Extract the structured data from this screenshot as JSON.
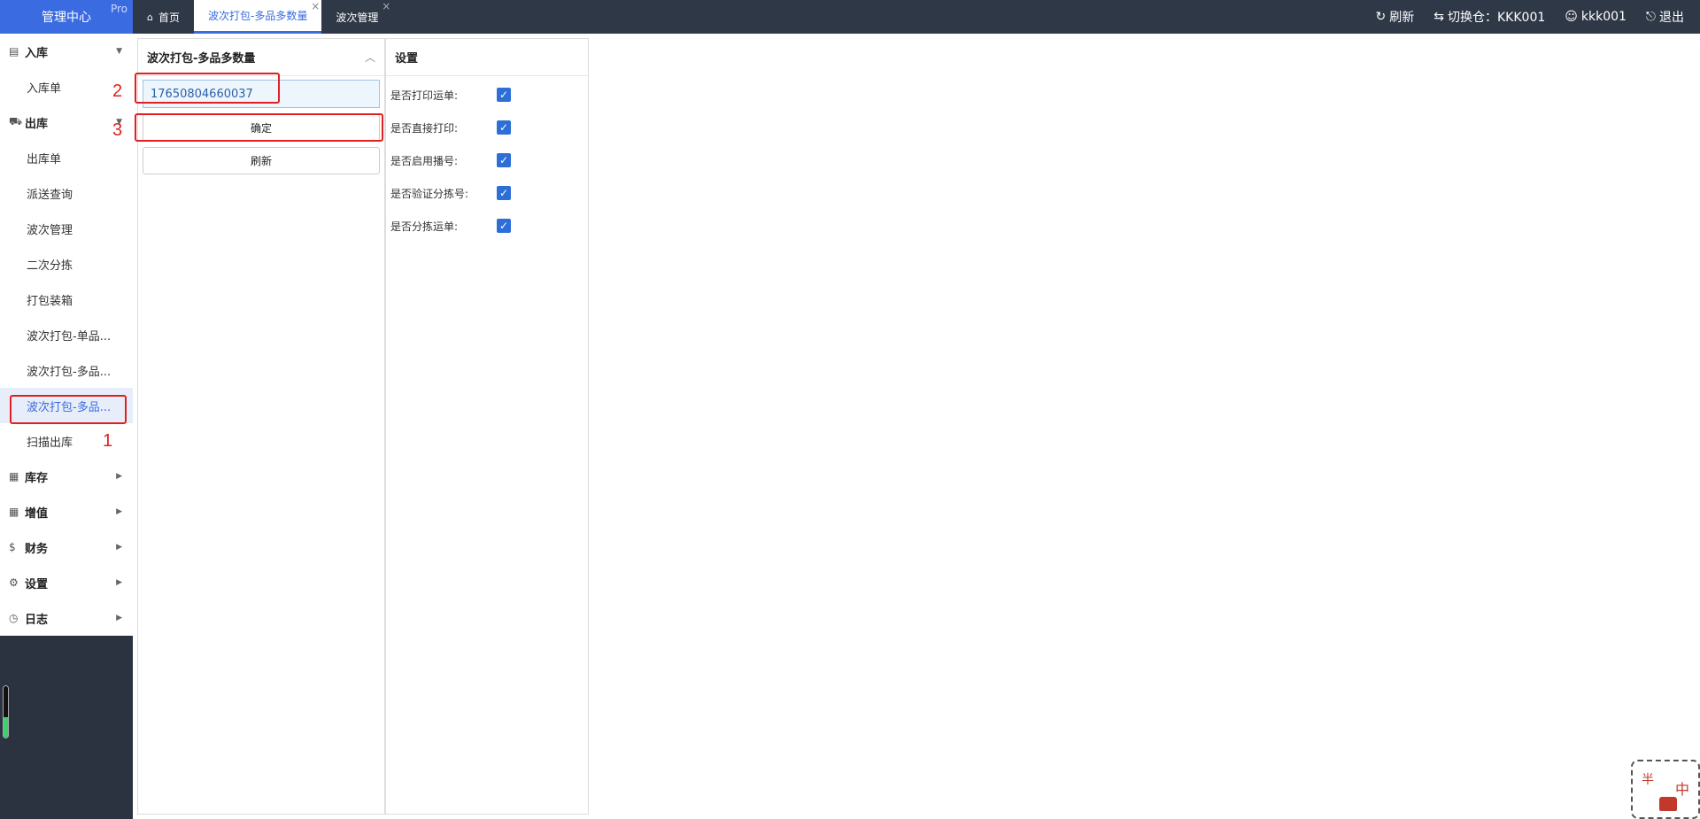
{
  "header": {
    "brand": "管理中心",
    "brand_badge": "Pro",
    "tabs": [
      {
        "label": "首页",
        "icon": "home-icon"
      },
      {
        "label": "波次打包-多品多数量",
        "active": true
      },
      {
        "label": "波次管理"
      }
    ],
    "close_glyph": "×",
    "actions": {
      "refresh": "刷新",
      "switch_warehouse": "切换仓：KKK001",
      "user": "kkk001",
      "logout": "退出"
    }
  },
  "sidebar": {
    "inbound": {
      "label": "入库",
      "items": [
        "入库单"
      ]
    },
    "outbound": {
      "label": "出库",
      "items": [
        "出库单",
        "派送查询",
        "波次管理",
        "二次分拣",
        "打包装箱",
        "波次打包-单品...",
        "波次打包-多品...",
        "波次打包-多品...",
        "扫描出库"
      ]
    },
    "inventory": {
      "label": "库存"
    },
    "value_added": {
      "label": "增值"
    },
    "finance": {
      "label": "财务"
    },
    "settings": {
      "label": "设置"
    },
    "log": {
      "label": "日志"
    }
  },
  "main": {
    "panel_title": "波次打包-多品多数量",
    "collapse_glyph": "︿",
    "scan_value": "17650804660037",
    "confirm_label": "确定",
    "refresh_label": "刷新"
  },
  "settings_panel": {
    "title": "设置",
    "options": [
      {
        "label": "是否打印运单:",
        "checked": true
      },
      {
        "label": "是否直接打印:",
        "checked": true
      },
      {
        "label": "是否启用播号:",
        "checked": true
      },
      {
        "label": "是否验证分拣号:",
        "checked": true
      },
      {
        "label": "是否分拣运单:",
        "checked": true
      }
    ]
  },
  "annotations": [
    "1",
    "2",
    "3"
  ],
  "colors": {
    "accent": "#3a6be0",
    "topbar": "#2f3847",
    "annotation": "#e02020"
  },
  "sticker": {
    "text1": "半",
    "text2": "中"
  }
}
